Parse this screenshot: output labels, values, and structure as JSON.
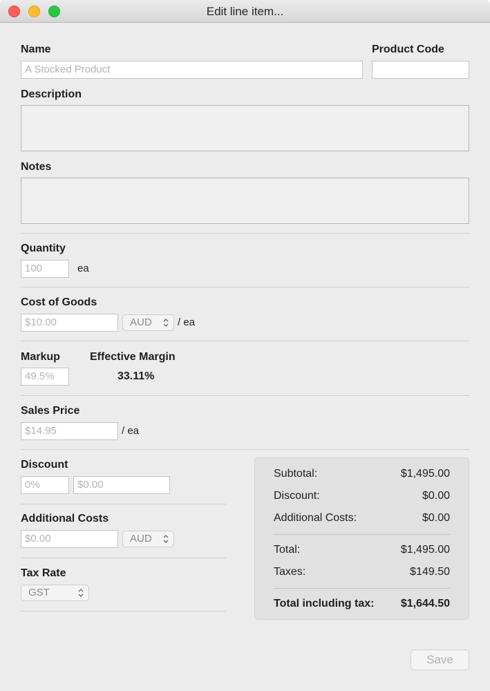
{
  "window": {
    "title": "Edit line item..."
  },
  "name": {
    "label": "Name",
    "placeholder": "A Stocked Product"
  },
  "product_code": {
    "label": "Product Code",
    "value": ""
  },
  "description": {
    "label": "Description"
  },
  "notes": {
    "label": "Notes"
  },
  "quantity": {
    "label": "Quantity",
    "placeholder": "100",
    "unit": "ea"
  },
  "cost_of_goods": {
    "label": "Cost of Goods",
    "placeholder": "$10.00",
    "currency": "AUD",
    "unit": "/ ea"
  },
  "markup": {
    "label": "Markup",
    "placeholder": "49.5%"
  },
  "effective_margin": {
    "label": "Effective Margin",
    "value": "33.11%"
  },
  "sales_price": {
    "label": "Sales Price",
    "placeholder": "$14.95",
    "unit": "/ ea"
  },
  "discount": {
    "label": "Discount",
    "percent_placeholder": "0%",
    "amount_placeholder": "$0.00"
  },
  "additional_costs": {
    "label": "Additional Costs",
    "placeholder": "$0.00",
    "currency": "AUD"
  },
  "tax_rate": {
    "label": "Tax Rate",
    "value": "GST"
  },
  "summary": {
    "subtotal": {
      "label": "Subtotal:",
      "value": "$1,495.00"
    },
    "discount": {
      "label": "Discount:",
      "value": "$0.00"
    },
    "additional_costs": {
      "label": "Additional Costs:",
      "value": "$0.00"
    },
    "total": {
      "label": "Total:",
      "value": "$1,495.00"
    },
    "taxes": {
      "label": "Taxes:",
      "value": "$149.50"
    },
    "total_incl_tax": {
      "label": "Total including tax:",
      "value": "$1,644.50"
    }
  },
  "save_label": "Save",
  "colors": {
    "close": "#fc5f57",
    "minimize": "#fdbc2e",
    "maximize": "#28c840"
  }
}
